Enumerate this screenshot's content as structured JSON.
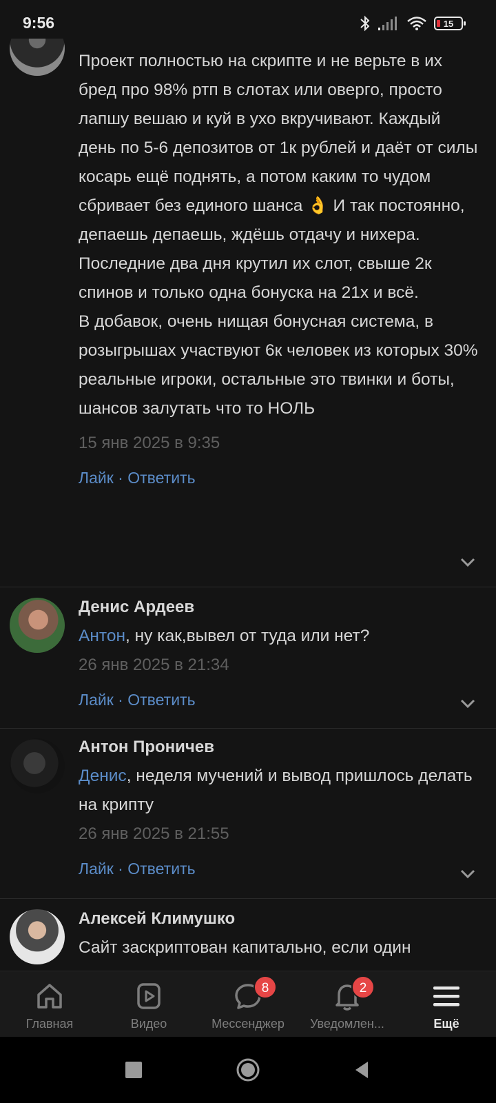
{
  "status": {
    "time": "9:56",
    "battery": "15"
  },
  "comments": [
    {
      "author": "",
      "text": "Проект полностью на скрипте и не верьте в их бред про 98% ртп в слотах или оверго, просто лапшу вешаю и куй в ухо вкручивают. Каждый день по 5-6 депозитов от 1к рублей и даёт от силы косарь ещё поднять, а потом каким то чудом сбривает без единого шанса 👌 И так постоянно, депаешь депаешь, ждёшь отдачу и нихера. Последние два дня крутил их слот, свыше 2к спинов и только одна бонуска на 21х и всё.\nВ добавок, очень нищая бонусная система, в розыгрышах участвуют 6к человек из которых 30% реальные игроки, остальные это твинки и боты, шансов залутать что то НОЛЬ",
      "date": "15 янв 2025 в 9:35"
    },
    {
      "author": "Денис Ардеев",
      "mention": "Антон",
      "text": ", ну как,вывел от туда или нет?",
      "date": "26 янв 2025 в 21:34"
    },
    {
      "author": "Антон Проничев",
      "mention": "Денис",
      "text": ", неделя мучений и вывод пришлось делать на крипту",
      "date": "26 янв 2025 в 21:55"
    },
    {
      "author": "Алексей Климушко",
      "text": "Сайт заскриптован капитально, если один",
      "date": ""
    }
  ],
  "actions": {
    "like": "Лайк",
    "sep": " · ",
    "reply": "Ответить"
  },
  "tabs": [
    {
      "label": "Главная",
      "icon": "home-icon"
    },
    {
      "label": "Видео",
      "icon": "video-icon"
    },
    {
      "label": "Мессенджер",
      "icon": "messenger-icon",
      "badge": "8"
    },
    {
      "label": "Уведомлен...",
      "icon": "bell-icon",
      "badge": "2"
    },
    {
      "label": "Ещё",
      "icon": "menu-icon",
      "active": true
    }
  ],
  "colors": {
    "link": "#5b8cc8",
    "badge": "#e64646",
    "background": "#141414"
  }
}
